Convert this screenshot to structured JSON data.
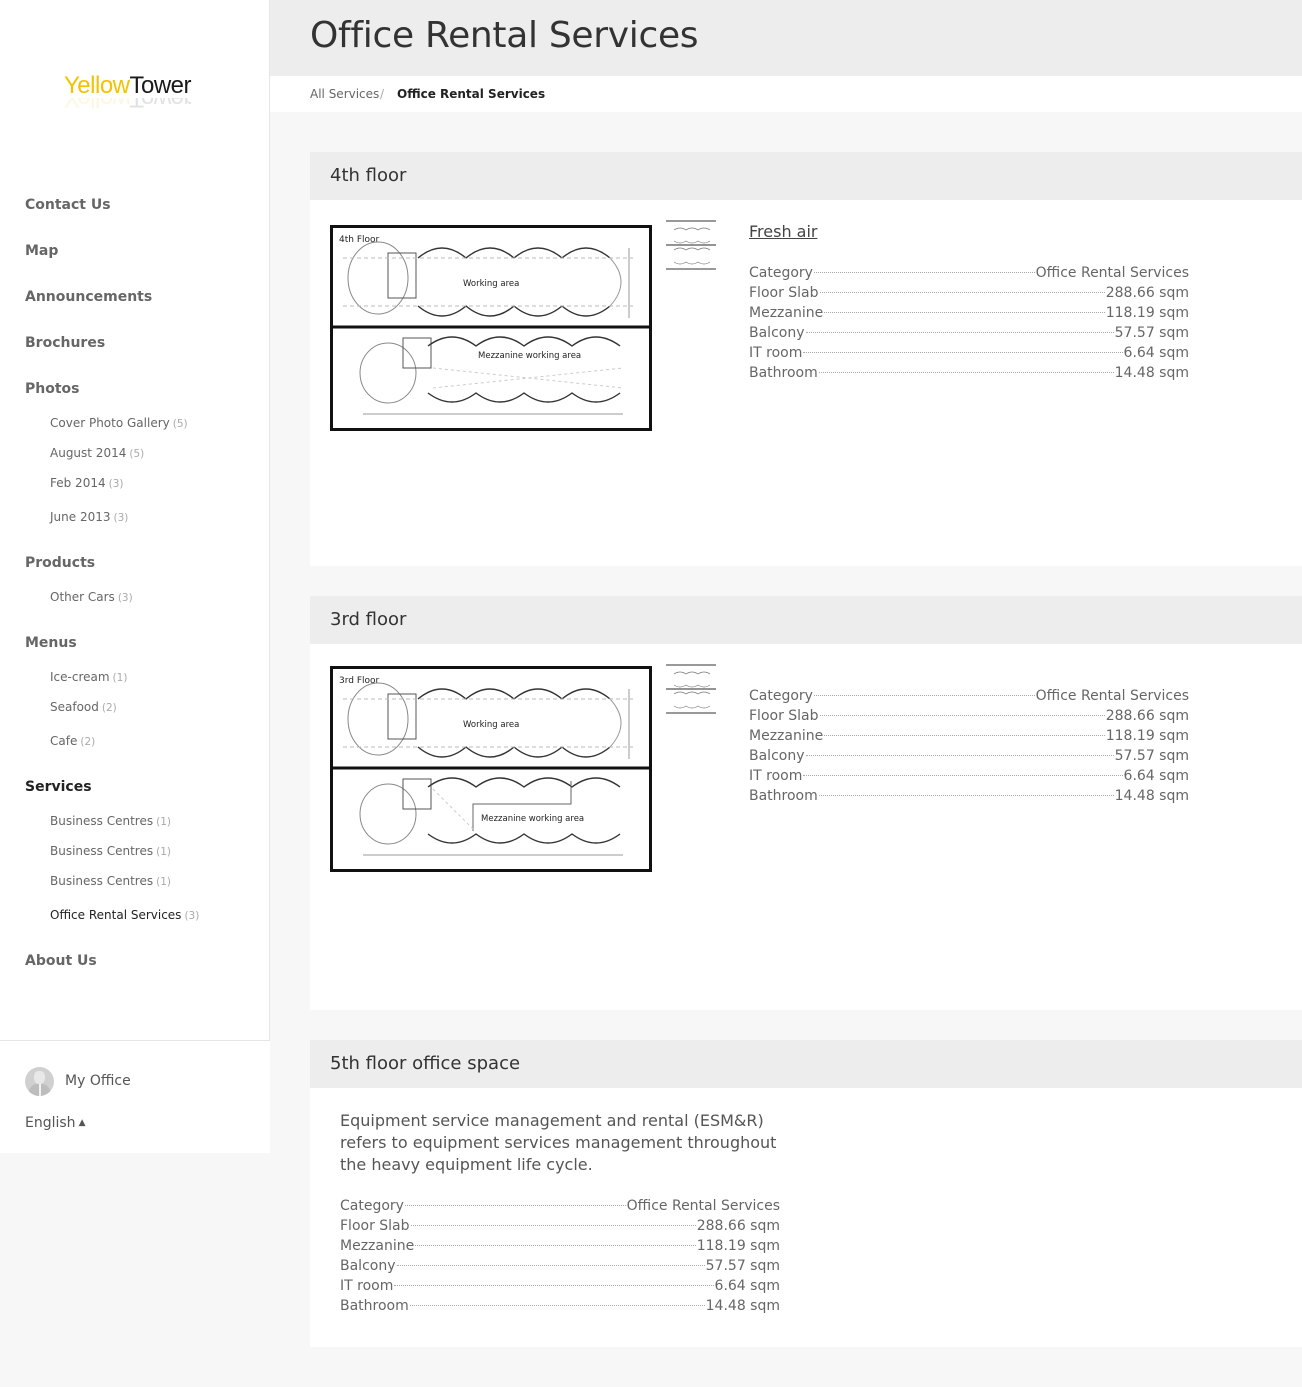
{
  "brand": {
    "logo_part1": "Yellow",
    "logo_part2": "Tower"
  },
  "sidebar": {
    "items": [
      {
        "label": "Contact Us",
        "children": []
      },
      {
        "label": "Map",
        "children": []
      },
      {
        "label": "Announcements",
        "children": []
      },
      {
        "label": "Brochures",
        "children": []
      },
      {
        "label": "Photos",
        "children": [
          {
            "label": "Cover Photo Gallery",
            "count": "(5)"
          },
          {
            "label": "August 2014",
            "count": "(5)"
          },
          {
            "label": "Feb 2014",
            "count": "(3)"
          },
          {
            "label": "June 2013",
            "count": "(3)"
          }
        ]
      },
      {
        "label": "Products",
        "children": [
          {
            "label": "Other Cars",
            "count": "(3)"
          }
        ]
      },
      {
        "label": "Menus",
        "children": [
          {
            "label": "Ice-cream",
            "count": "(1)"
          },
          {
            "label": "Seafood",
            "count": "(2)"
          },
          {
            "label": "Cafe",
            "count": "(2)"
          }
        ]
      },
      {
        "label": "Services",
        "active": true,
        "children": [
          {
            "label": "Business Centres",
            "count": "(1)"
          },
          {
            "label": "Business Centres",
            "count": "(1)"
          },
          {
            "label": "Business Centres",
            "count": "(1)"
          },
          {
            "label": "Office Rental Services",
            "count": "(3)",
            "active": true
          }
        ]
      },
      {
        "label": "About Us",
        "children": []
      }
    ],
    "footer": {
      "user_label": "My Office",
      "language": "English",
      "language_icon": "chevron-up-icon"
    }
  },
  "header": {
    "title": "Office Rental Services"
  },
  "breadcrumb": {
    "parent": "All Services",
    "separator": "/",
    "current": "Office Rental Services"
  },
  "listings": [
    {
      "title": "4th floor",
      "image_caption": "4th Floor",
      "plan_labels": {
        "upper": "Working area",
        "lower": "Mezzanine working area"
      },
      "link": "Fresh air",
      "specs": [
        {
          "label": "Category",
          "value": "Office Rental Services"
        },
        {
          "label": "Floor Slab",
          "value": "288.66 sqm"
        },
        {
          "label": "Mezzanine",
          "value": "118.19 sqm"
        },
        {
          "label": "Balcony",
          "value": "57.57 sqm"
        },
        {
          "label": "IT room",
          "value": "6.64 sqm"
        },
        {
          "label": "Bathroom",
          "value": "14.48 sqm"
        }
      ]
    },
    {
      "title": "3rd floor",
      "image_caption": "3rd Floor",
      "plan_labels": {
        "upper": "Working area",
        "lower": "Mezzanine working area"
      },
      "specs": [
        {
          "label": "Category",
          "value": "Office Rental Services"
        },
        {
          "label": "Floor Slab",
          "value": "288.66 sqm"
        },
        {
          "label": "Mezzanine",
          "value": "118.19 sqm"
        },
        {
          "label": "Balcony",
          "value": "57.57 sqm"
        },
        {
          "label": "IT room",
          "value": "6.64 sqm"
        },
        {
          "label": "Bathroom",
          "value": "14.48 sqm"
        }
      ]
    },
    {
      "title": "5th floor office space",
      "description": "Equipment service management and rental (ESM&R) refers to equipment services management throughout the heavy equipment life cycle.",
      "specs": [
        {
          "label": "Category",
          "value": "Office Rental Services"
        },
        {
          "label": "Floor Slab",
          "value": "288.66 sqm"
        },
        {
          "label": "Mezzanine",
          "value": "118.19 sqm"
        },
        {
          "label": "Balcony",
          "value": "57.57 sqm"
        },
        {
          "label": "IT room",
          "value": "6.64 sqm"
        },
        {
          "label": "Bathroom",
          "value": "14.48 sqm"
        }
      ]
    }
  ],
  "colors": {
    "brand_yellow": "#f4c200",
    "header_bg": "#ededed",
    "page_bg": "#f7f7f7"
  }
}
